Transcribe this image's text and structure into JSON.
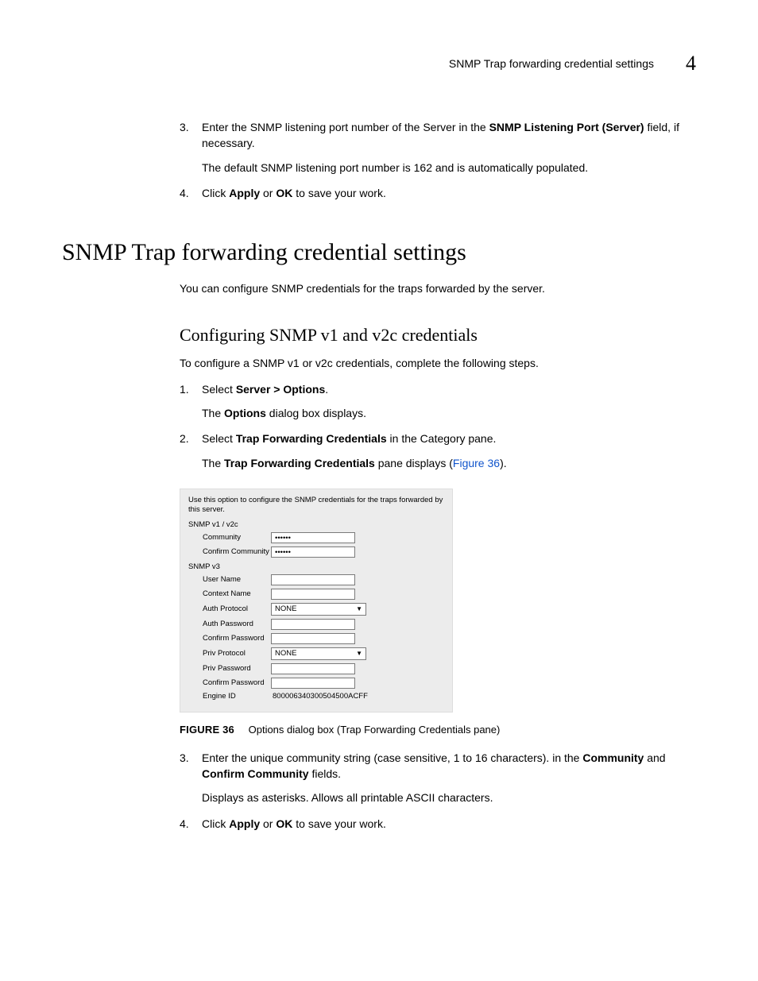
{
  "header": {
    "title": "SNMP Trap forwarding credential settings",
    "chapter_number": "4"
  },
  "top_steps": [
    {
      "num": "3",
      "segments": [
        {
          "t": "Enter the SNMP listening port number of the Server in the "
        },
        {
          "t": "SNMP Listening Port (Server)",
          "bold": true
        },
        {
          "t": " field, if necessary."
        }
      ],
      "sub": "The default SNMP listening port number is 162 and is automatically populated."
    },
    {
      "num": "4",
      "segments": [
        {
          "t": "Click "
        },
        {
          "t": "Apply",
          "bold": true
        },
        {
          "t": " or "
        },
        {
          "t": "OK",
          "bold": true
        },
        {
          "t": " to save your work."
        }
      ]
    }
  ],
  "h1": "SNMP Trap forwarding credential settings",
  "intro1": "You can configure SNMP credentials for the traps forwarded by the server.",
  "h2": "Configuring SNMP v1 and v2c credentials",
  "intro2": "To configure a SNMP v1 or v2c credentials, complete the following steps.",
  "mid_steps": [
    {
      "num": "1",
      "segments": [
        {
          "t": "Select "
        },
        {
          "t": "Server > Options",
          "bold": true
        },
        {
          "t": "."
        }
      ],
      "sub_segments": [
        {
          "t": "The "
        },
        {
          "t": "Options",
          "bold": true
        },
        {
          "t": " dialog box displays."
        }
      ]
    },
    {
      "num": "2",
      "segments": [
        {
          "t": "Select "
        },
        {
          "t": "Trap Forwarding Credentials",
          "bold": true
        },
        {
          "t": " in the Category pane."
        }
      ],
      "sub_segments": [
        {
          "t": "The "
        },
        {
          "t": "Trap Forwarding Credentials",
          "bold": true
        },
        {
          "t": " pane displays ("
        },
        {
          "t": "Figure 36",
          "link": true
        },
        {
          "t": ")."
        }
      ]
    }
  ],
  "dialog": {
    "hint": "Use this option to configure the SNMP credentials for the traps forwarded by this server.",
    "section1": "SNMP v1 / v2c",
    "community_label": "Community",
    "community_value": "••••••",
    "confirm_community_label": "Confirm Community",
    "confirm_community_value": "••••••",
    "section2": "SNMP v3",
    "username_label": "User Name",
    "context_label": "Context Name",
    "authproto_label": "Auth Protocol",
    "authproto_value": "NONE",
    "authpass_label": "Auth Password",
    "confirmpass1_label": "Confirm Password",
    "privproto_label": "Priv Protocol",
    "privproto_value": "NONE",
    "privpass_label": "Priv Password",
    "confirmpass2_label": "Confirm Password",
    "engine_label": "Engine ID",
    "engine_value": "800006340300504500ACFF"
  },
  "figure": {
    "label": "FIGURE 36",
    "title": "Options dialog box (Trap Forwarding Credentials pane)"
  },
  "bottom_steps": [
    {
      "num": "3",
      "segments": [
        {
          "t": "Enter the unique community string (case sensitive, 1 to 16 characters). in the "
        },
        {
          "t": "Community",
          "bold": true
        },
        {
          "t": " and "
        },
        {
          "t": "Confirm Community",
          "bold": true
        },
        {
          "t": " fields."
        }
      ],
      "sub": "Displays as asterisks. Allows all printable ASCII characters."
    },
    {
      "num": "4",
      "segments": [
        {
          "t": "Click "
        },
        {
          "t": "Apply",
          "bold": true
        },
        {
          "t": " or "
        },
        {
          "t": "OK",
          "bold": true
        },
        {
          "t": " to save your work."
        }
      ]
    }
  ]
}
